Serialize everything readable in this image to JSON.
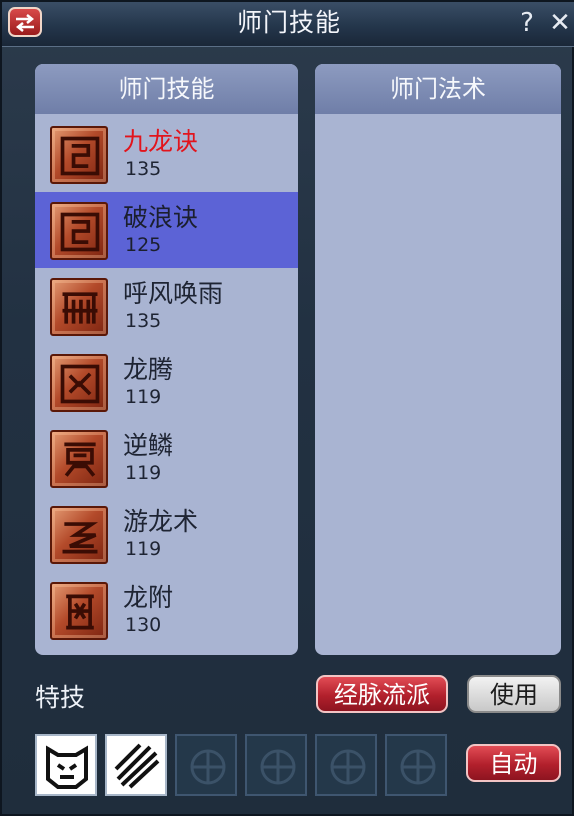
{
  "window": {
    "title": "师门技能"
  },
  "titlebar": {
    "help_label": "?",
    "close_label": "✕",
    "swap_icon": "swap-arrows-icon"
  },
  "left_panel": {
    "header": "师门技能",
    "skills": [
      {
        "name": "九龙诀",
        "level": "135",
        "highlight": true,
        "selected": false,
        "icon": "seal-icon"
      },
      {
        "name": "破浪诀",
        "level": "125",
        "highlight": false,
        "selected": true,
        "icon": "seal-icon"
      },
      {
        "name": "呼风唤雨",
        "level": "135",
        "highlight": false,
        "selected": false,
        "icon": "rain-icon"
      },
      {
        "name": "龙腾",
        "level": "119",
        "highlight": false,
        "selected": false,
        "icon": "dragon-face-icon"
      },
      {
        "name": "逆鳞",
        "level": "119",
        "highlight": false,
        "selected": false,
        "icon": "scale-icon"
      },
      {
        "name": "游龙术",
        "level": "119",
        "highlight": false,
        "selected": false,
        "icon": "swimming-dragon-icon"
      },
      {
        "name": "龙附",
        "level": "130",
        "highlight": false,
        "selected": false,
        "icon": "totem-icon"
      }
    ]
  },
  "right_panel": {
    "header": "师门法术"
  },
  "bottom": {
    "special_label": "特技",
    "meridian_button": "经脉流派",
    "use_button": "使用",
    "auto_button": "自动",
    "slots": [
      {
        "state": "filled",
        "icon": "tiger-mask-icon"
      },
      {
        "state": "filled",
        "icon": "claw-slash-icon"
      },
      {
        "state": "empty",
        "icon": "empty-slot-icon"
      },
      {
        "state": "empty",
        "icon": "empty-slot-icon"
      },
      {
        "state": "empty",
        "icon": "empty-slot-icon"
      },
      {
        "state": "empty",
        "icon": "empty-slot-icon"
      }
    ]
  },
  "colors": {
    "panel_bg": "#a9b4d2",
    "selected_row": "#5c63d6",
    "highlight_text": "#e2141c",
    "button_red": "#b2202c"
  }
}
